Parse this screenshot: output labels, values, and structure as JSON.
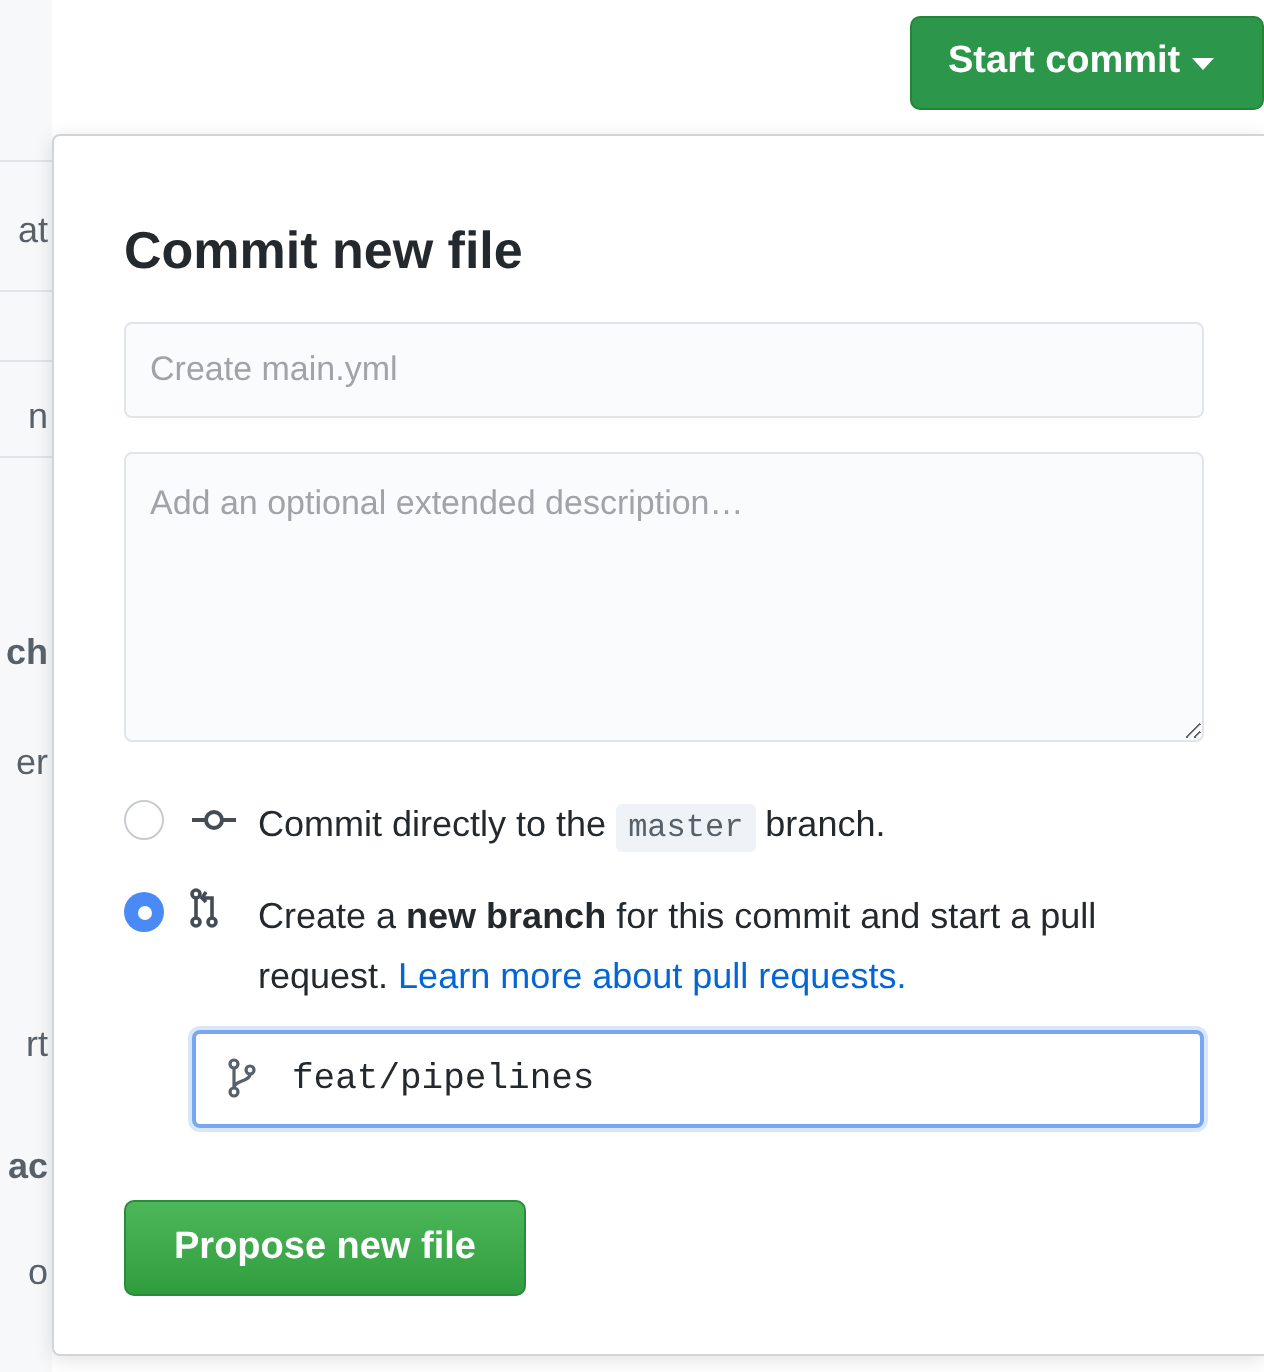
{
  "header": {
    "start_commit_button": "Start commit"
  },
  "background_fragments": [
    "at",
    "n",
    "ch",
    "er",
    "rt",
    "ac",
    "o"
  ],
  "dialog": {
    "title": "Commit new file",
    "summary": {
      "placeholder": "Create main.yml"
    },
    "description": {
      "placeholder": "Add an optional extended description…"
    },
    "options": [
      {
        "kind": "direct",
        "text_before": "Commit directly to the",
        "branch": "master",
        "text_after": "branch.",
        "selected": false
      },
      {
        "kind": "new_branch",
        "text": "Create a **new branch** for this commit and start a pull request.",
        "link": "Learn more about pull requests.",
        "selected": true
      }
    ],
    "branch_name": {
      "value": "feat/pipelines"
    },
    "submit_button": "Propose new file"
  }
}
